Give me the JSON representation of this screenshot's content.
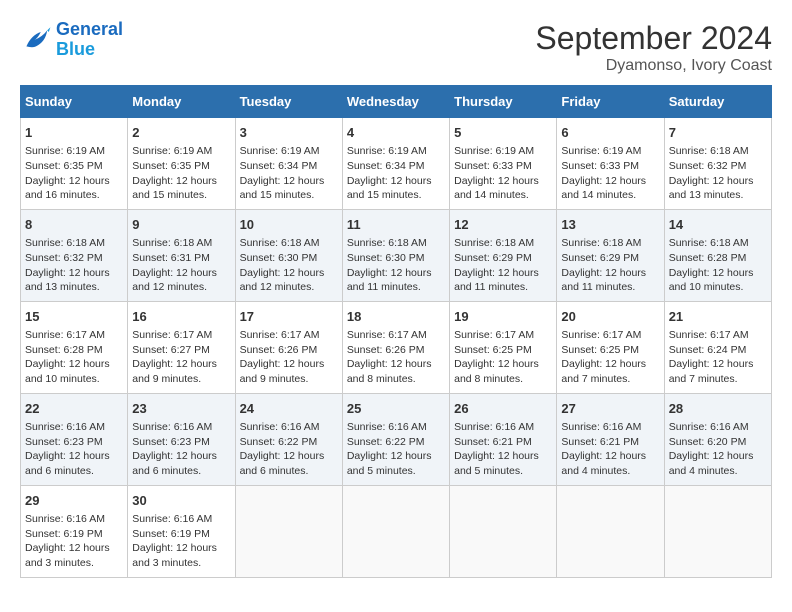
{
  "logo": {
    "line1": "General",
    "line2": "Blue"
  },
  "title": "September 2024",
  "location": "Dyamonso, Ivory Coast",
  "days_of_week": [
    "Sunday",
    "Monday",
    "Tuesday",
    "Wednesday",
    "Thursday",
    "Friday",
    "Saturday"
  ],
  "weeks": [
    [
      {
        "day": "1",
        "sunrise": "6:19 AM",
        "sunset": "6:35 PM",
        "daylight": "12 hours and 16 minutes."
      },
      {
        "day": "2",
        "sunrise": "6:19 AM",
        "sunset": "6:35 PM",
        "daylight": "12 hours and 15 minutes."
      },
      {
        "day": "3",
        "sunrise": "6:19 AM",
        "sunset": "6:34 PM",
        "daylight": "12 hours and 15 minutes."
      },
      {
        "day": "4",
        "sunrise": "6:19 AM",
        "sunset": "6:34 PM",
        "daylight": "12 hours and 15 minutes."
      },
      {
        "day": "5",
        "sunrise": "6:19 AM",
        "sunset": "6:33 PM",
        "daylight": "12 hours and 14 minutes."
      },
      {
        "day": "6",
        "sunrise": "6:19 AM",
        "sunset": "6:33 PM",
        "daylight": "12 hours and 14 minutes."
      },
      {
        "day": "7",
        "sunrise": "6:18 AM",
        "sunset": "6:32 PM",
        "daylight": "12 hours and 13 minutes."
      }
    ],
    [
      {
        "day": "8",
        "sunrise": "6:18 AM",
        "sunset": "6:32 PM",
        "daylight": "12 hours and 13 minutes."
      },
      {
        "day": "9",
        "sunrise": "6:18 AM",
        "sunset": "6:31 PM",
        "daylight": "12 hours and 12 minutes."
      },
      {
        "day": "10",
        "sunrise": "6:18 AM",
        "sunset": "6:30 PM",
        "daylight": "12 hours and 12 minutes."
      },
      {
        "day": "11",
        "sunrise": "6:18 AM",
        "sunset": "6:30 PM",
        "daylight": "12 hours and 11 minutes."
      },
      {
        "day": "12",
        "sunrise": "6:18 AM",
        "sunset": "6:29 PM",
        "daylight": "12 hours and 11 minutes."
      },
      {
        "day": "13",
        "sunrise": "6:18 AM",
        "sunset": "6:29 PM",
        "daylight": "12 hours and 11 minutes."
      },
      {
        "day": "14",
        "sunrise": "6:18 AM",
        "sunset": "6:28 PM",
        "daylight": "12 hours and 10 minutes."
      }
    ],
    [
      {
        "day": "15",
        "sunrise": "6:17 AM",
        "sunset": "6:28 PM",
        "daylight": "12 hours and 10 minutes."
      },
      {
        "day": "16",
        "sunrise": "6:17 AM",
        "sunset": "6:27 PM",
        "daylight": "12 hours and 9 minutes."
      },
      {
        "day": "17",
        "sunrise": "6:17 AM",
        "sunset": "6:26 PM",
        "daylight": "12 hours and 9 minutes."
      },
      {
        "day": "18",
        "sunrise": "6:17 AM",
        "sunset": "6:26 PM",
        "daylight": "12 hours and 8 minutes."
      },
      {
        "day": "19",
        "sunrise": "6:17 AM",
        "sunset": "6:25 PM",
        "daylight": "12 hours and 8 minutes."
      },
      {
        "day": "20",
        "sunrise": "6:17 AM",
        "sunset": "6:25 PM",
        "daylight": "12 hours and 7 minutes."
      },
      {
        "day": "21",
        "sunrise": "6:17 AM",
        "sunset": "6:24 PM",
        "daylight": "12 hours and 7 minutes."
      }
    ],
    [
      {
        "day": "22",
        "sunrise": "6:16 AM",
        "sunset": "6:23 PM",
        "daylight": "12 hours and 6 minutes."
      },
      {
        "day": "23",
        "sunrise": "6:16 AM",
        "sunset": "6:23 PM",
        "daylight": "12 hours and 6 minutes."
      },
      {
        "day": "24",
        "sunrise": "6:16 AM",
        "sunset": "6:22 PM",
        "daylight": "12 hours and 6 minutes."
      },
      {
        "day": "25",
        "sunrise": "6:16 AM",
        "sunset": "6:22 PM",
        "daylight": "12 hours and 5 minutes."
      },
      {
        "day": "26",
        "sunrise": "6:16 AM",
        "sunset": "6:21 PM",
        "daylight": "12 hours and 5 minutes."
      },
      {
        "day": "27",
        "sunrise": "6:16 AM",
        "sunset": "6:21 PM",
        "daylight": "12 hours and 4 minutes."
      },
      {
        "day": "28",
        "sunrise": "6:16 AM",
        "sunset": "6:20 PM",
        "daylight": "12 hours and 4 minutes."
      }
    ],
    [
      {
        "day": "29",
        "sunrise": "6:16 AM",
        "sunset": "6:19 PM",
        "daylight": "12 hours and 3 minutes."
      },
      {
        "day": "30",
        "sunrise": "6:16 AM",
        "sunset": "6:19 PM",
        "daylight": "12 hours and 3 minutes."
      },
      null,
      null,
      null,
      null,
      null
    ]
  ],
  "labels": {
    "sunrise": "Sunrise:",
    "sunset": "Sunset:",
    "daylight": "Daylight:"
  }
}
